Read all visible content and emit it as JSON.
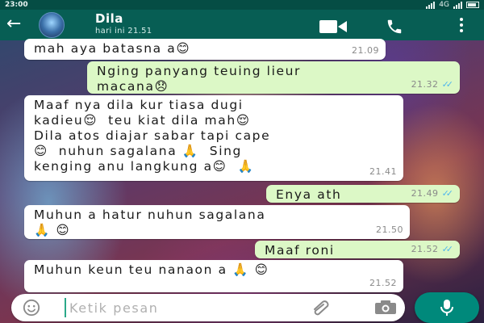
{
  "status_bar": {
    "time": "23:00",
    "network": "4G"
  },
  "header": {
    "contact_name": "Dila",
    "last_seen": "hari ini 21.51",
    "icons": [
      "back-arrow-icon",
      "avatar",
      "video-call-icon",
      "phone-call-icon",
      "menu-icon"
    ]
  },
  "messages": [
    {
      "direction": "in",
      "lines": [
        "mah aya batasna a😊"
      ],
      "time": "21.09",
      "ticks": ""
    },
    {
      "direction": "out",
      "lines": [
        "Nging panyang teuing lieur",
        "macana😞"
      ],
      "time": "21.32",
      "ticks": "✓✓"
    },
    {
      "direction": "in",
      "lines": [
        "Maaf nya dila kur tiasa dugi",
        "kadieu😌  teu kiat dila mah😌",
        "Dila atos diajar sabar tapi cape",
        "😊  nuhun sagalana 🙏  Sing",
        "kenging anu langkung a😊  🙏"
      ],
      "time": "21.41",
      "ticks": ""
    },
    {
      "direction": "out",
      "lines": [
        "Enya ath"
      ],
      "time": "21.49",
      "ticks": "✓✓"
    },
    {
      "direction": "in",
      "lines": [
        "Muhun a hatur nuhun sagalana",
        "🙏 😊"
      ],
      "time": "21.50",
      "ticks": ""
    },
    {
      "direction": "out",
      "lines": [
        "Maaf roni"
      ],
      "time": "21.52",
      "ticks": "✓✓"
    },
    {
      "direction": "in",
      "lines": [
        "Muhun keun teu nanaon a 🙏 😊"
      ],
      "time": "21.52",
      "ticks": ""
    }
  ],
  "composer": {
    "placeholder": "Ketik pesan",
    "value": ""
  },
  "colors": {
    "header_bg": "#075e54",
    "status_bg": "#054d44",
    "outgoing_bubble": "#dcf8c6",
    "incoming_bubble": "#ffffff",
    "read_ticks": "#4fb6ec",
    "fab": "#00897b"
  }
}
